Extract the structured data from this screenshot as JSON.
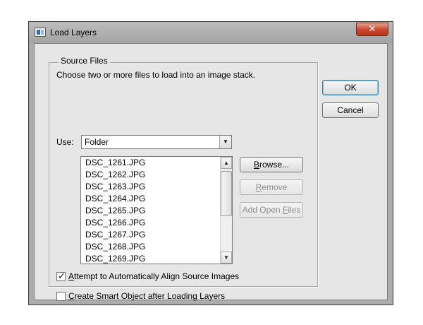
{
  "window": {
    "title": "Load Layers",
    "close_glyph": "✕"
  },
  "source_files": {
    "group_title": "Source Files",
    "instruction": "Choose two or more files to load into an image stack.",
    "use_label": "Use:",
    "use_selected": "Folder",
    "files": [
      "DSC_1261.JPG",
      "DSC_1262.JPG",
      "DSC_1263.JPG",
      "DSC_1264.JPG",
      "DSC_1265.JPG",
      "DSC_1266.JPG",
      "DSC_1267.JPG",
      "DSC_1268.JPG",
      "DSC_1269.JPG"
    ]
  },
  "buttons": {
    "ok": "OK",
    "cancel": "Cancel",
    "browse_mnemonic": "B",
    "browse_rest": "rowse...",
    "remove_mnemonic": "R",
    "remove_rest": "emove",
    "add_open_files_prefix": "Add Open ",
    "add_open_files_mnemonic": "F",
    "add_open_files_rest": "iles"
  },
  "options": {
    "align": {
      "checked": true,
      "mnemonic": "A",
      "label_rest": "ttempt to Automatically Align Source Images"
    },
    "smart_object": {
      "checked": false,
      "mnemonic": "C",
      "label_rest": "reate Smart Object after Loading Layers"
    }
  },
  "colors": {
    "dialog_bg": "#e6e6e6",
    "frame": "#acacac",
    "close_button": "#c9452c",
    "default_button_border": "#3c7fb1",
    "disabled_text": "#8d8d8d"
  },
  "icons": {
    "app": "photoshop-app-icon",
    "close": "close-icon",
    "dropdown": "triangle-down-icon",
    "scroll_up": "triangle-up-icon",
    "scroll_down": "triangle-down-icon",
    "check": "checkmark-icon"
  }
}
